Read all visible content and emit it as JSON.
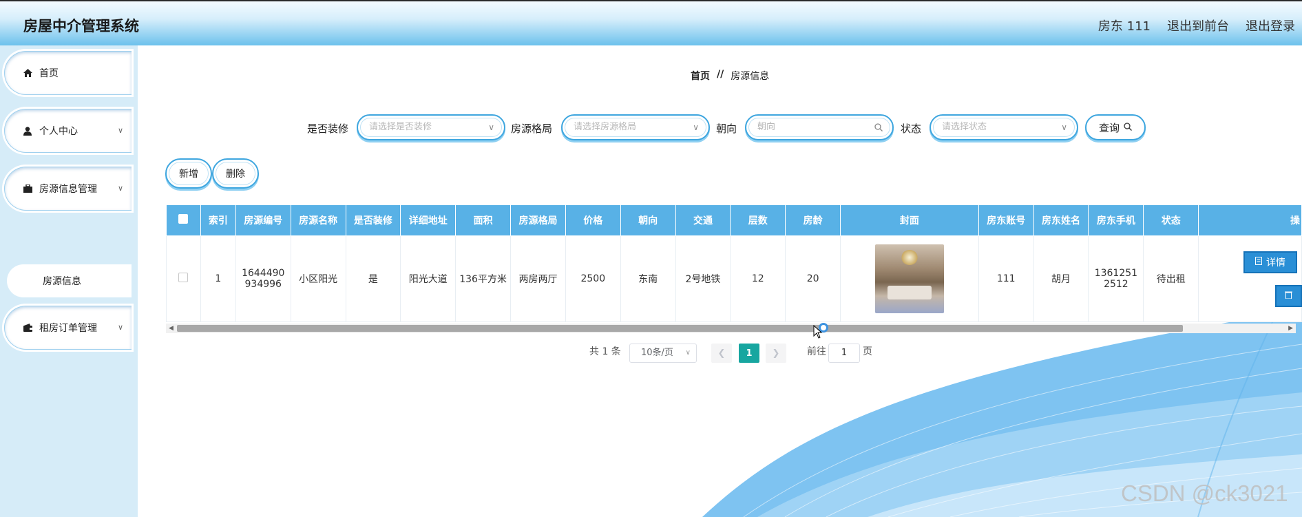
{
  "header": {
    "title": "房屋中介管理系统",
    "user": "房东 111",
    "to_front": "退出到前台",
    "logout": "退出登录"
  },
  "sidebar": {
    "items": [
      {
        "label": "首页",
        "icon": "home-icon"
      },
      {
        "label": "个人中心",
        "icon": "user-icon"
      },
      {
        "label": "房源信息管理",
        "icon": "briefcase-icon"
      },
      {
        "label": "租房订单管理",
        "icon": "wallet-icon"
      }
    ],
    "subitem": "房源信息"
  },
  "breadcrumb": {
    "home": "首页",
    "sep": "//",
    "current": "房源信息"
  },
  "filters": {
    "decorated_label": "是否装修",
    "decorated_placeholder": "请选择是否装修",
    "layout_label": "房源格局",
    "layout_placeholder": "请选择房源格局",
    "orientation_label": "朝向",
    "orientation_placeholder": "朝向",
    "status_label": "状态",
    "status_placeholder": "请选择状态",
    "query_label": "查询"
  },
  "actions": {
    "add": "新增",
    "delete": "删除"
  },
  "table": {
    "headers": [
      "索引",
      "房源编号",
      "房源名称",
      "是否装修",
      "详细地址",
      "面积",
      "房源格局",
      "价格",
      "朝向",
      "交通",
      "层数",
      "房龄",
      "封面",
      "房东账号",
      "房东姓名",
      "房东手机",
      "状态",
      "操"
    ],
    "rows": [
      {
        "index": "1",
        "code": "1644490934996",
        "name": "小区阳光",
        "decorated": "是",
        "address": "阳光大道",
        "area": "136平方米",
        "layout": "两房两厅",
        "price": "2500",
        "orientation": "东南",
        "traffic": "2号地铁",
        "floors": "12",
        "age": "20",
        "owner_account": "111",
        "owner_name": "胡月",
        "owner_phone": "13612512512",
        "status": "待出租"
      }
    ],
    "detail_label": "详情"
  },
  "pagination": {
    "total": "共 1 条",
    "page_size": "10条/页",
    "current_page": "1",
    "goto_label": "前往",
    "goto_value": "1",
    "page_suffix": "页"
  },
  "watermark": "CSDN @ck3021",
  "colors": {
    "accent": "#3ea6df",
    "header_th": "#58b1e6",
    "page_active": "#17a6a0",
    "sidebar_bg": "#d6ecf8"
  }
}
